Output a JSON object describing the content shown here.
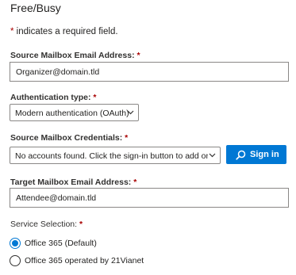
{
  "header": {
    "title": "Free/Busy"
  },
  "required_note": {
    "star": "*",
    "text": " indicates a required field."
  },
  "source_mailbox": {
    "label": "Source Mailbox Email Address:",
    "star": "*",
    "value": "Organizer@domain.tld"
  },
  "auth_type": {
    "label": "Authentication type:",
    "star": "*",
    "selected": "Modern authentication (OAuth)"
  },
  "credentials": {
    "label": "Source Mailbox Credentials:",
    "star": "*",
    "selected": "No accounts found. Click the sign-in button to add one.",
    "signin_label": "Sign in"
  },
  "target_mailbox": {
    "label": "Target Mailbox Email Address:",
    "star": "*",
    "value": "Attendee@domain.tld"
  },
  "service": {
    "label": "Service Selection:",
    "star": "*",
    "options": [
      {
        "label": "Office 365 (Default)",
        "checked": true
      },
      {
        "label": "Office 365 operated by 21Vianet",
        "checked": false
      }
    ]
  },
  "colors": {
    "accent": "#0078d4",
    "required": "#a80000",
    "border": "#8a8886"
  }
}
